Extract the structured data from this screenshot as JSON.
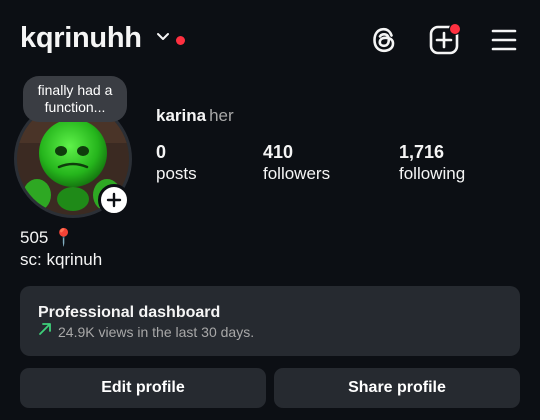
{
  "header": {
    "username": "kqrinuhh",
    "icons": [
      "chevron-down-icon",
      "threads-icon",
      "create-post-icon",
      "menu-icon"
    ],
    "notify_color": "#ff3040"
  },
  "avatar": {
    "note": "finally had a function...",
    "add_icon": "plus-icon"
  },
  "profile": {
    "name": "karina",
    "pronouns": "her"
  },
  "stats": [
    {
      "value": "0",
      "label": "posts"
    },
    {
      "value": "410",
      "label": "followers"
    },
    {
      "value": "1,716",
      "label": "following"
    }
  ],
  "bio": {
    "line1": "505 📍",
    "line2": "sc: kqrinuh"
  },
  "dashboard": {
    "title": "Professional dashboard",
    "subtitle": "24.9K views in the last 30 days.",
    "arrow_color": "#3ed07a"
  },
  "actions": {
    "edit": "Edit profile",
    "share": "Share profile"
  }
}
